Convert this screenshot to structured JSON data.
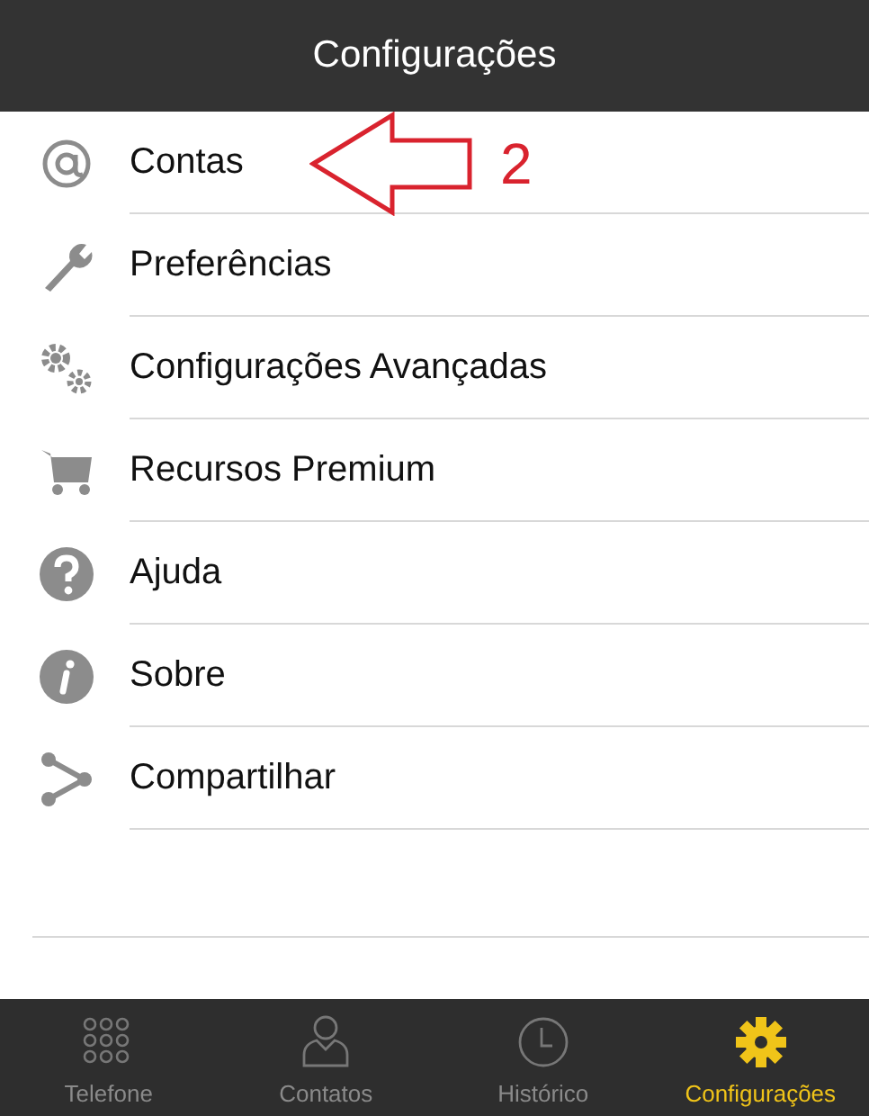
{
  "header": {
    "title": "Configurações"
  },
  "menu": [
    {
      "label": "Contas",
      "kind": "at"
    },
    {
      "label": "Preferências",
      "kind": "wrench"
    },
    {
      "label": "Configurações Avançadas",
      "kind": "gears"
    },
    {
      "label": "Recursos Premium",
      "kind": "cart"
    },
    {
      "label": "Ajuda",
      "kind": "help"
    },
    {
      "label": "Sobre",
      "kind": "info"
    },
    {
      "label": "Compartilhar",
      "kind": "share"
    }
  ],
  "annotation": {
    "label": "2"
  },
  "tab_bar": [
    {
      "label": "Telefone",
      "kind": "keypad",
      "selected": false
    },
    {
      "label": "Contatos",
      "kind": "person",
      "selected": false
    },
    {
      "label": "Histórico",
      "kind": "clock",
      "selected": false
    },
    {
      "label": "Configurações",
      "kind": "gear",
      "selected": true
    }
  ]
}
